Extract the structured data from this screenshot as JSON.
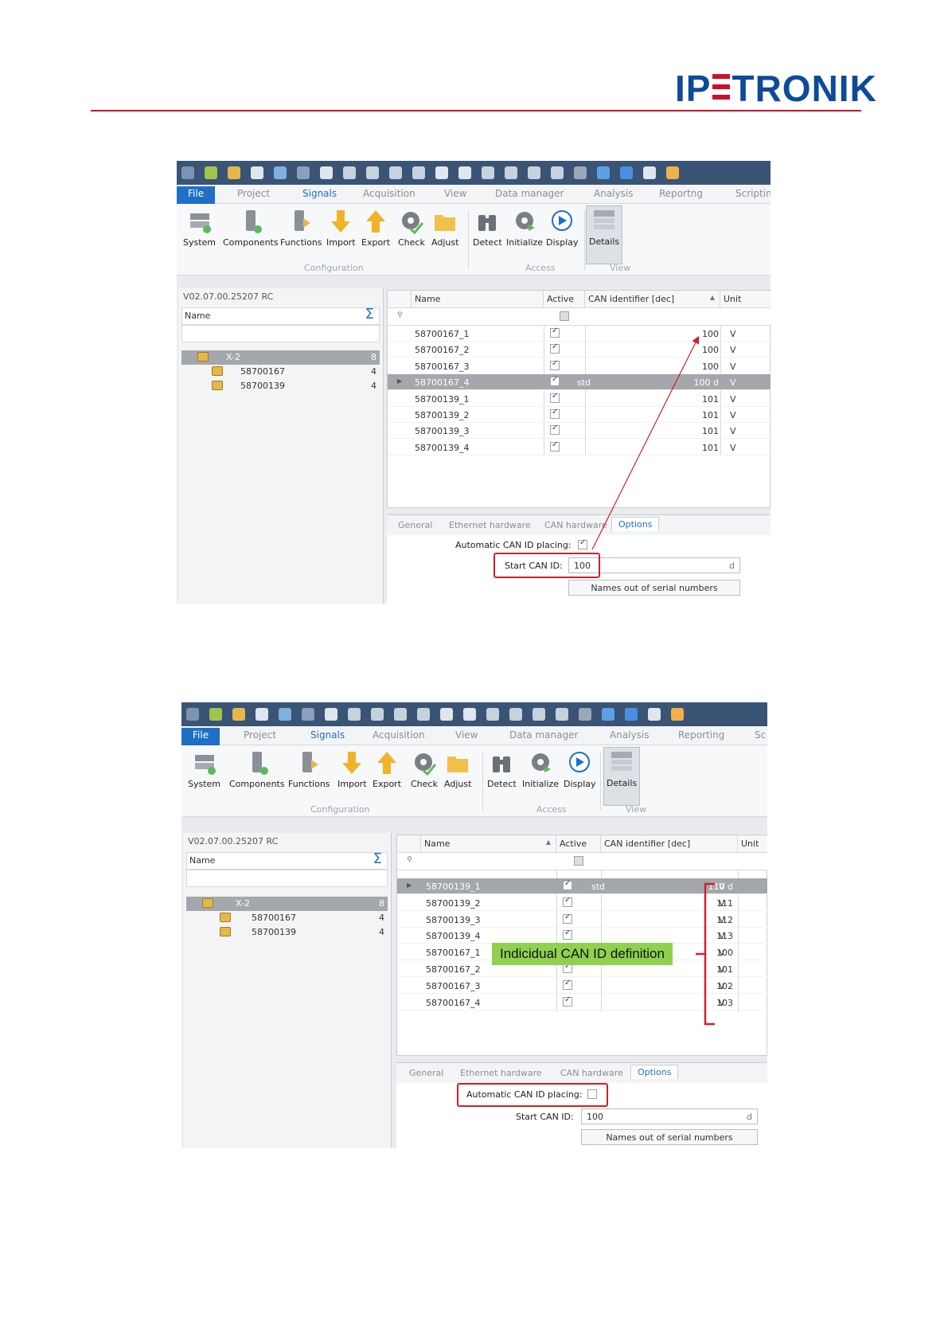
{
  "brand": {
    "logo_left": "IP",
    "logo_right": "TRONIK",
    "accent": "#c8102e",
    "logo_color": "#0d4a9a"
  },
  "qat_icons": [
    "app-icon",
    "new-icon",
    "open-icon",
    "save-icon",
    "save-as-icon",
    "auto-icon",
    "print-icon",
    "cut-icon",
    "copy-icon",
    "paste-icon",
    "clipboard-icon",
    "import-icon",
    "export-icon",
    "delete-icon",
    "delete-all-icon",
    "undo-icon",
    "redo-icon",
    "settings-icon",
    "tools-icon",
    "help-icon",
    "edit-icon",
    "touch-icon"
  ],
  "screenshots": [
    {
      "menu_tabs": [
        "File",
        "Project",
        "Signals",
        "Acquisition",
        "View",
        "Data manager",
        "Analysis",
        "Reportng",
        "Scriptin"
      ],
      "ribbon": {
        "buttons": [
          "System",
          "Components",
          "Functions",
          "Import",
          "Export",
          "Check",
          "Adjust",
          "Detect",
          "Initialize",
          "Display",
          "Details"
        ],
        "groups": [
          "Configuration",
          "Access",
          "View"
        ]
      },
      "version": "V02.07.00.25207 RC",
      "tree_header": "Name",
      "tree": [
        {
          "label": "X-2",
          "count": "8"
        },
        {
          "label": "58700167",
          "count": "4"
        },
        {
          "label": "58700139",
          "count": "4"
        }
      ],
      "columns": {
        "name": "Name",
        "active": "Active",
        "can": "CAN identifier [dec]",
        "unit": "Unit"
      },
      "rows": [
        {
          "name": "58700167_1",
          "std": "",
          "can": "100",
          "unit": "V"
        },
        {
          "name": "58700167_2",
          "std": "",
          "can": "100",
          "unit": "V"
        },
        {
          "name": "58700167_3",
          "std": "",
          "can": "100",
          "unit": "V"
        },
        {
          "name": "58700167_4",
          "std": "std",
          "can": "100  d",
          "unit": "V"
        },
        {
          "name": "58700139_1",
          "std": "",
          "can": "101",
          "unit": "V"
        },
        {
          "name": "58700139_2",
          "std": "",
          "can": "101",
          "unit": "V"
        },
        {
          "name": "58700139_3",
          "std": "",
          "can": "101",
          "unit": "V"
        },
        {
          "name": "58700139_4",
          "std": "",
          "can": "101",
          "unit": "V"
        }
      ],
      "option_tabs": [
        "General",
        "Ethernet hardware",
        "CAN hardware",
        "Options"
      ],
      "options": {
        "auto_label": "Automatic CAN ID placing:",
        "auto_checked": true,
        "start_label": "Start CAN ID:",
        "start_value": "100",
        "start_unit": "d",
        "names_button": "Names out of serial numbers"
      }
    },
    {
      "menu_tabs": [
        "File",
        "Project",
        "Signals",
        "Acquisition",
        "View",
        "Data manager",
        "Analysis",
        "Reporting",
        "Sc"
      ],
      "ribbon": {
        "buttons": [
          "System",
          "Components",
          "Functions",
          "Import",
          "Export",
          "Check",
          "Adjust",
          "Detect",
          "Initialize",
          "Display",
          "Details"
        ],
        "groups": [
          "Configuration",
          "Access",
          "View"
        ]
      },
      "version": "V02.07.00.25207 RC",
      "tree_header": "Name",
      "tree": [
        {
          "label": "X-2",
          "count": "8"
        },
        {
          "label": "58700167",
          "count": "4"
        },
        {
          "label": "58700139",
          "count": "4"
        }
      ],
      "columns": {
        "name": "Name",
        "active": "Active",
        "can": "CAN identifier [dec]",
        "unit": "Unit"
      },
      "rows": [
        {
          "name": "58700139_1",
          "std": "std",
          "can": "110  d",
          "unit": "V"
        },
        {
          "name": "58700139_2",
          "std": "",
          "can": "111",
          "unit": "V"
        },
        {
          "name": "58700139_3",
          "std": "",
          "can": "112",
          "unit": "V"
        },
        {
          "name": "58700139_4",
          "std": "",
          "can": "113",
          "unit": "V"
        },
        {
          "name": "58700167_1",
          "std": "",
          "can": "100",
          "unit": "V"
        },
        {
          "name": "58700167_2",
          "std": "",
          "can": "101",
          "unit": "V"
        },
        {
          "name": "58700167_3",
          "std": "",
          "can": "102",
          "unit": "V"
        },
        {
          "name": "58700167_4",
          "std": "",
          "can": "103",
          "unit": "V"
        }
      ],
      "option_tabs": [
        "General",
        "Ethernet hardware",
        "CAN hardware",
        "Options"
      ],
      "options": {
        "auto_label": "Automatic CAN ID placing:",
        "auto_checked": false,
        "start_label": "Start CAN ID:",
        "start_value": "100",
        "start_unit": "d",
        "names_button": "Names out of serial numbers"
      },
      "annotation": "Indicidual CAN ID definition"
    }
  ]
}
